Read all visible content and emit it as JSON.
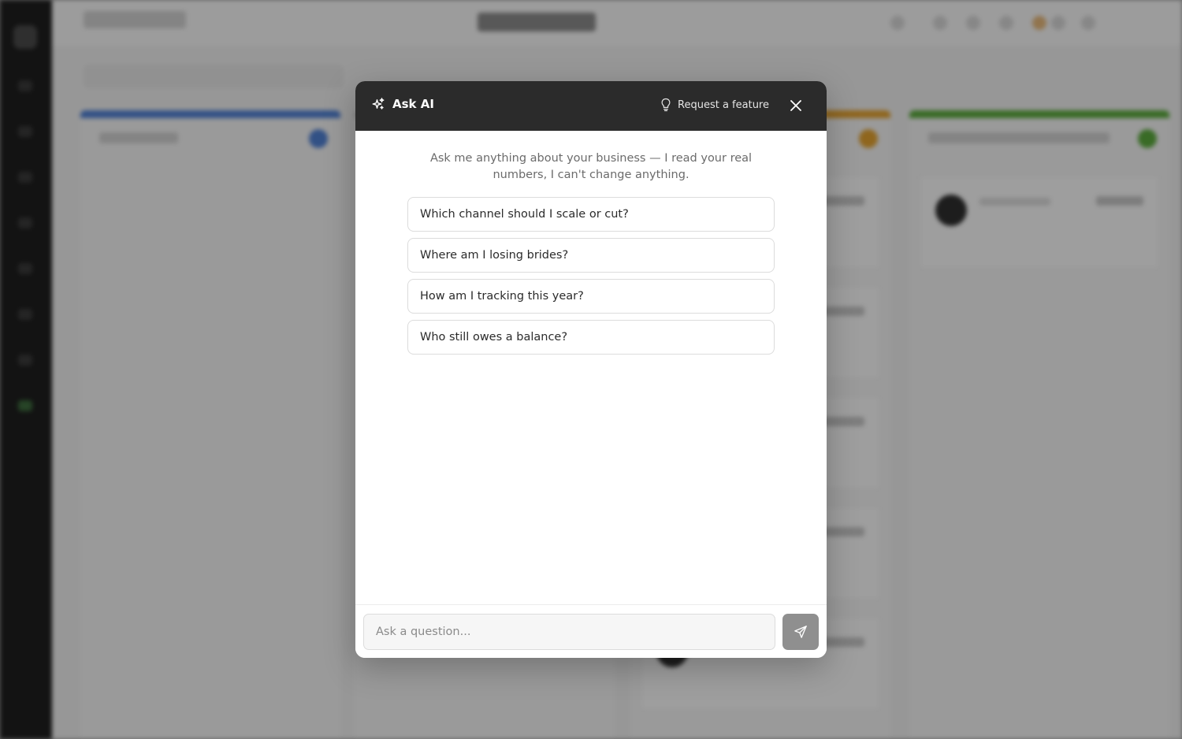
{
  "modal": {
    "title": "Ask AI",
    "title_icon": "sparkle-icon",
    "request_feature_label": "Request a feature",
    "request_feature_icon": "lightbulb-icon",
    "close_icon": "close-icon",
    "intro_text": "Ask me anything about your business — I read your real numbers, I can't change anything.",
    "suggestions": [
      {
        "label": "Which channel should I scale or cut?"
      },
      {
        "label": "Where am I losing brides?"
      },
      {
        "label": "How am I tracking this year?"
      },
      {
        "label": "Who still owes a balance?"
      }
    ],
    "input": {
      "value": "",
      "placeholder": "Ask a question..."
    },
    "send_icon": "send-icon"
  },
  "colors": {
    "header_bg": "#2b2b2b",
    "send_button": "#8f8f8f",
    "column_blue": "#4f7fd1",
    "column_orange": "#e0a030",
    "column_green": "#5aa83c"
  }
}
